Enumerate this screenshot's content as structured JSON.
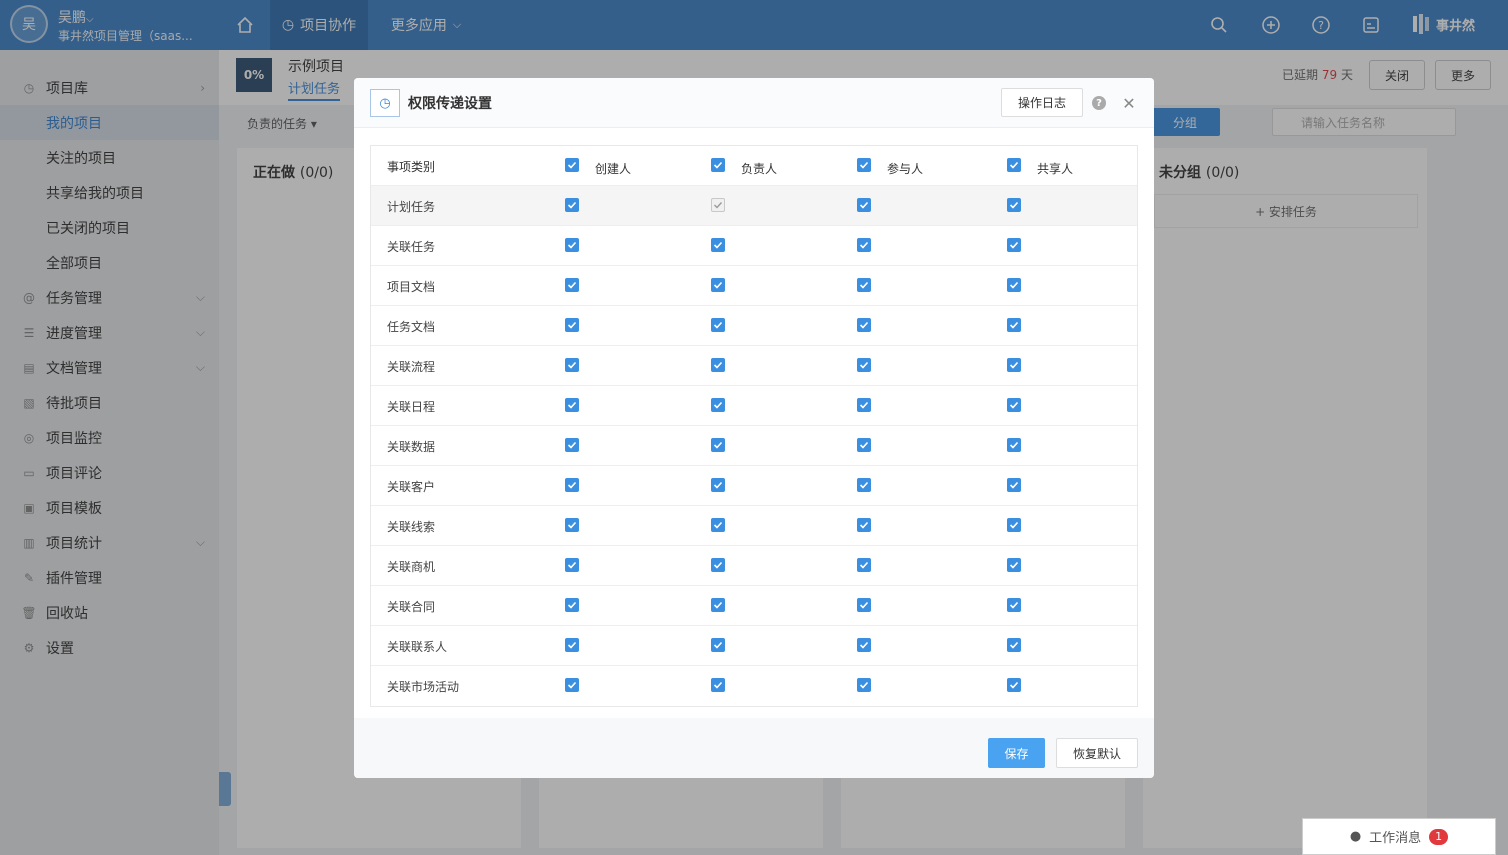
{
  "topbar": {
    "user_avatar": "吴",
    "user_name": "吴鹏",
    "user_sub": "事井然项目管理（saas...",
    "nav_project": "项目协作",
    "nav_more": "更多应用",
    "brand": "事井然"
  },
  "sidebar": {
    "items": [
      {
        "label": "项目库",
        "icon": "library-icon"
      },
      {
        "label": "我的项目"
      },
      {
        "label": "关注的项目"
      },
      {
        "label": "共享给我的项目"
      },
      {
        "label": "已关闭的项目"
      },
      {
        "label": "全部项目"
      },
      {
        "label": "任务管理",
        "icon": "task-icon"
      },
      {
        "label": "进度管理",
        "icon": "progress-icon"
      },
      {
        "label": "文档管理",
        "icon": "document-icon"
      },
      {
        "label": "待批项目",
        "icon": "approval-icon"
      },
      {
        "label": "项目监控",
        "icon": "monitor-icon"
      },
      {
        "label": "项目评论",
        "icon": "comment-icon"
      },
      {
        "label": "项目模板",
        "icon": "template-icon"
      },
      {
        "label": "项目统计",
        "icon": "stats-icon"
      },
      {
        "label": "插件管理",
        "icon": "plugin-icon"
      },
      {
        "label": "回收站",
        "icon": "trash-icon"
      },
      {
        "label": "设置",
        "icon": "settings-icon"
      }
    ]
  },
  "project": {
    "logo_text": "0%",
    "name": "示例项目",
    "tab": "计划任务",
    "filter": "负责的任务",
    "col_doing": "正在做",
    "col_doing_count": "(0/0)",
    "late_label": "已延期",
    "late_days": "79",
    "late_unit": "天",
    "close_btn": "关闭",
    "more_btn": "更多",
    "group_btn": "分组",
    "search_placeholder": "请输入任务名称",
    "unassigned": "未分组",
    "unassigned_count": "(0/0)",
    "arrange": "+ 安排任务"
  },
  "messages": {
    "label": "工作消息",
    "count": "1"
  },
  "modal": {
    "title": "权限传递设置",
    "log_btn": "操作日志",
    "save_btn": "保存",
    "reset_btn": "恢复默认",
    "headers": [
      "事项类别",
      "创建人",
      "负责人",
      "参与人",
      "共享人"
    ],
    "rows": [
      {
        "label": "计划任务",
        "checks": [
          true,
          true,
          true,
          true
        ],
        "disabled": [
          false,
          true,
          false,
          false
        ]
      },
      {
        "label": "关联任务",
        "checks": [
          true,
          true,
          true,
          true
        ],
        "disabled": [
          false,
          false,
          false,
          false
        ]
      },
      {
        "label": "项目文档",
        "checks": [
          true,
          true,
          true,
          true
        ],
        "disabled": [
          false,
          false,
          false,
          false
        ]
      },
      {
        "label": "任务文档",
        "checks": [
          true,
          true,
          true,
          true
        ],
        "disabled": [
          false,
          false,
          false,
          false
        ]
      },
      {
        "label": "关联流程",
        "checks": [
          true,
          true,
          true,
          true
        ],
        "disabled": [
          false,
          false,
          false,
          false
        ]
      },
      {
        "label": "关联日程",
        "checks": [
          true,
          true,
          true,
          true
        ],
        "disabled": [
          false,
          false,
          false,
          false
        ]
      },
      {
        "label": "关联数据",
        "checks": [
          true,
          true,
          true,
          true
        ],
        "disabled": [
          false,
          false,
          false,
          false
        ]
      },
      {
        "label": "关联客户",
        "checks": [
          true,
          true,
          true,
          true
        ],
        "disabled": [
          false,
          false,
          false,
          false
        ]
      },
      {
        "label": "关联线索",
        "checks": [
          true,
          true,
          true,
          true
        ],
        "disabled": [
          false,
          false,
          false,
          false
        ]
      },
      {
        "label": "关联商机",
        "checks": [
          true,
          true,
          true,
          true
        ],
        "disabled": [
          false,
          false,
          false,
          false
        ]
      },
      {
        "label": "关联合同",
        "checks": [
          true,
          true,
          true,
          true
        ],
        "disabled": [
          false,
          false,
          false,
          false
        ]
      },
      {
        "label": "关联联系人",
        "checks": [
          true,
          true,
          true,
          true
        ],
        "disabled": [
          false,
          false,
          false,
          false
        ]
      },
      {
        "label": "关联市场活动",
        "checks": [
          true,
          true,
          true,
          true
        ],
        "disabled": [
          false,
          false,
          false,
          false
        ]
      }
    ]
  }
}
